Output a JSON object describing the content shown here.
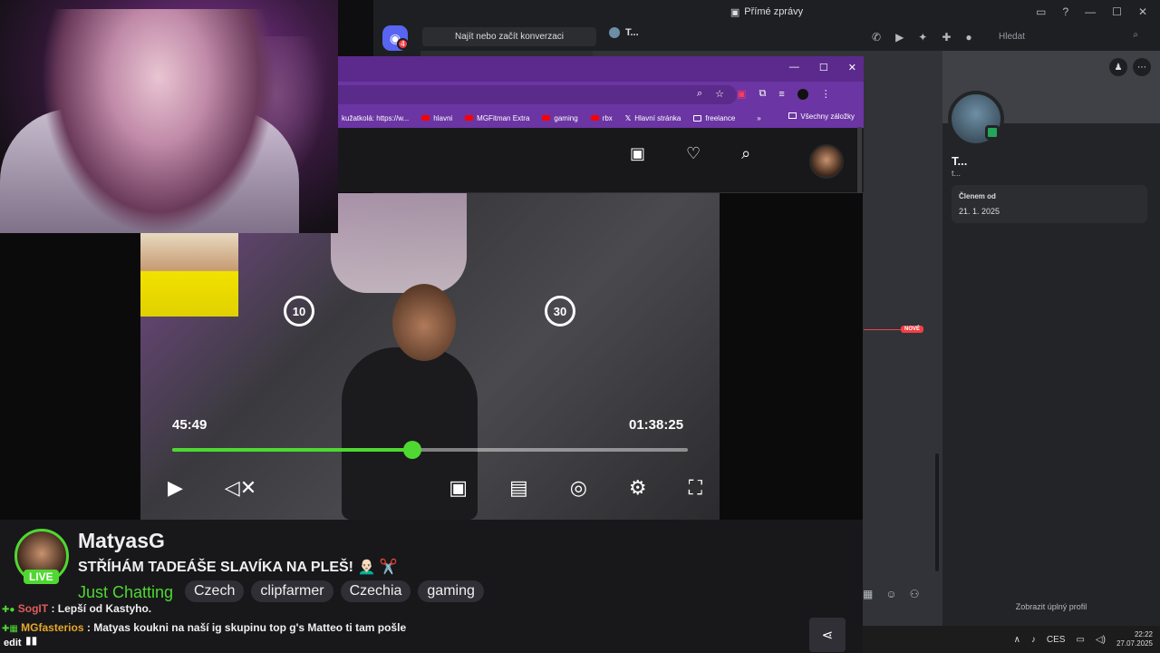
{
  "discord": {
    "window_title": "Přímé zprávy",
    "home_badge": "4",
    "dm_search": "Najít nebo začít konverzaci",
    "active_tab": "T...",
    "header_search_placeholder": "Hledat",
    "new_marker": "NOVÉ",
    "profile": {
      "name": "T...",
      "subtitle": "t...",
      "member_since_label": "Členem od",
      "member_since_value": "21. 1. 2025",
      "full_profile_link": "Zobrazit úplný profil"
    }
  },
  "browser": {
    "bookmarks": [
      {
        "label": "kužatkolá: https://w...",
        "type": "text"
      },
      {
        "label": "hlavni",
        "type": "youtube"
      },
      {
        "label": "MGFitman Extra",
        "type": "youtube"
      },
      {
        "label": "gaming",
        "type": "youtube"
      },
      {
        "label": "rbx",
        "type": "youtube"
      },
      {
        "label": "Hlavní stránka",
        "type": "x"
      },
      {
        "label": "freelance",
        "type": "folder"
      }
    ],
    "all_bookmarks": "Všechny záložky"
  },
  "player": {
    "skip_back": "10",
    "skip_forward": "30",
    "current_time": "45:49",
    "duration": "01:38:25",
    "progress": 0.4655
  },
  "stream": {
    "channel_name": "MatyasG",
    "live_label": "LIVE",
    "title": "STŘÍHÁM TADEÁŠE SLAVÍKA NA PLEŠ! 👨🏻‍🦲 ✂️",
    "category": "Just Chatting",
    "tags": [
      "Czech",
      "clipfarmer",
      "Czechia",
      "gaming"
    ]
  },
  "chat": [
    {
      "user": "SogIT",
      "message": ": Lepší od Kastyho."
    },
    {
      "user": "MGfasterios",
      "message": ": Matyas koukni na naší ig skupinu top g's Matteo ti tam pošle"
    }
  ],
  "overlay": {
    "edit_label": "edit"
  },
  "taskbar": {
    "lang": "CES",
    "time": "22:22",
    "date": "27.07.2025"
  },
  "colors": {
    "accent_green": "#4fd832",
    "discord_blurple": "#5865f2",
    "chrome_purple": "#6b35a3"
  }
}
